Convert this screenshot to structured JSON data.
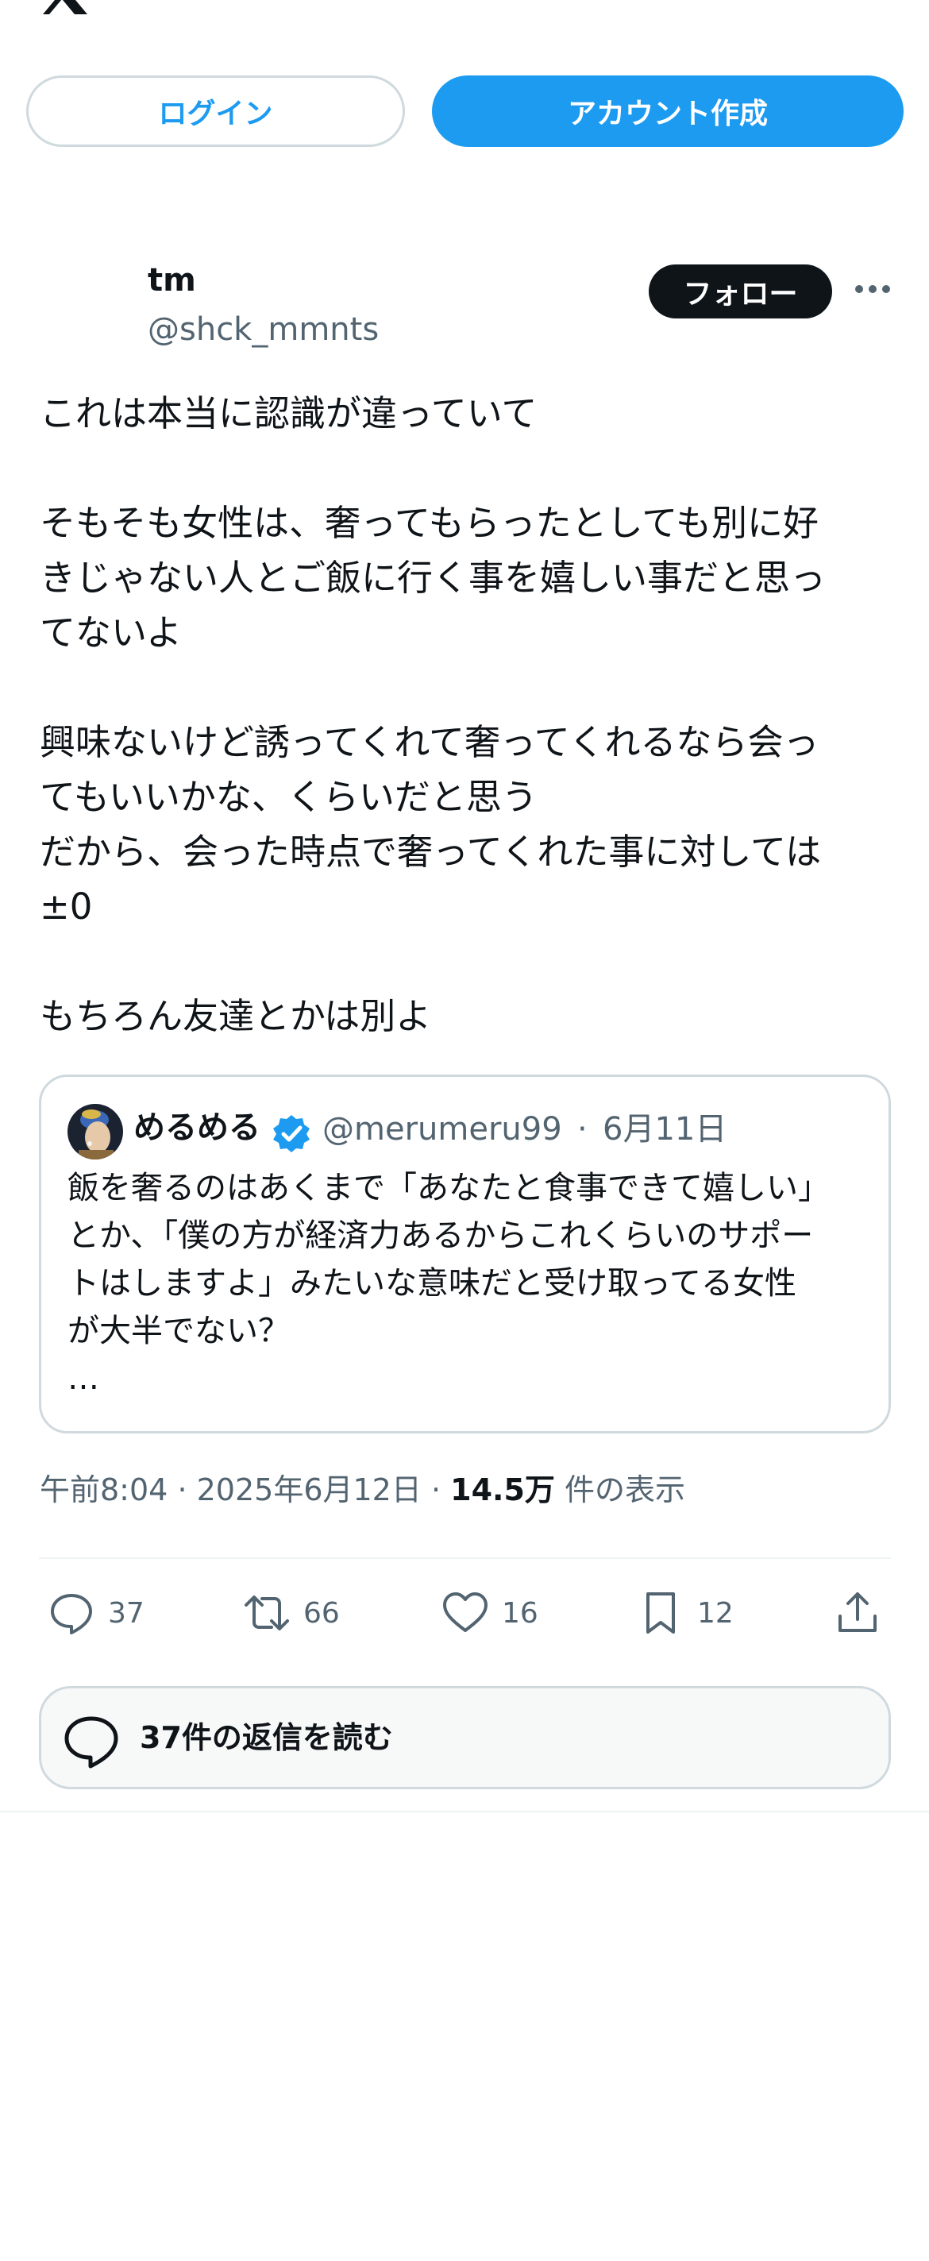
{
  "header": {
    "logo_icon": "x-logo-icon",
    "login_label": "ログイン",
    "signup_label": "アカウント作成"
  },
  "colors": {
    "accent": "#1d9bf0",
    "text": "#0f1419",
    "muted": "#536471",
    "border": "#cfd9de"
  },
  "tweet": {
    "author_name": "tm",
    "author_handle": "@shck_mmnts",
    "follow_label": "フォロー",
    "more_icon": "more-dots-icon",
    "body_lines": [
      "これは本当に認識が違っていて",
      "",
      "そもそも女性は、奢ってもらったとしても別に好",
      "きじゃない人とご飯に行く事を嬉しい事だと思っ",
      "てないよ",
      "",
      "興味ないけど誘ってくれて奢ってくれるなら会っ",
      "てもいいかな、くらいだと思う",
      "だから、会った時点で奢ってくれた事に対しては",
      "±0",
      "",
      "もちろん友達とかは別よ"
    ]
  },
  "quote": {
    "name": "めるめる",
    "verified_icon": "verified-badge-icon",
    "handle": "@merumeru99",
    "separator": "·",
    "date": "6月11日",
    "text_lines": [
      "飯を奢るのはあくまで「あなたと食事できて嬉しい」",
      "とか、「僕の方が経済力あるからこれくらいのサポー",
      "トはしますよ」みたいな意味だと受け取ってる女性",
      "が大半でない？",
      "…"
    ]
  },
  "meta": {
    "time": "午前8:04",
    "date": "2025年6月12日",
    "separator": "·",
    "views_count": "14.5万",
    "views_label": "件の表示"
  },
  "actions": {
    "reply_count": "37",
    "retweet_count": "66",
    "like_count": "16",
    "bookmark_count": "12"
  },
  "replies": {
    "label": "37件の返信を読む"
  }
}
